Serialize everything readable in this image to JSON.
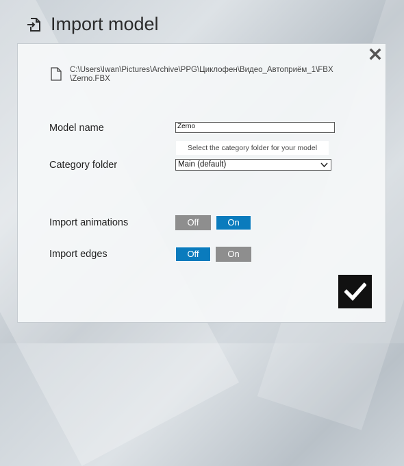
{
  "header": {
    "title": "Import model",
    "icon": "import-file-icon"
  },
  "dialog": {
    "close_icon": "close-icon",
    "file_path": "C:\\Users\\Iwan\\Pictures\\Archive\\PPG\\Циклофен\\Видео_Автоприём_1\\FBX\\Zerno.FBX",
    "model_name": {
      "label": "Model name",
      "value": "Zerno"
    },
    "category_folder": {
      "label": "Category folder",
      "hint": "Select the category folder for your model",
      "selected": "Main (default)"
    },
    "import_animations": {
      "label": "Import animations",
      "off_label": "Off",
      "on_label": "On",
      "selected": "On"
    },
    "import_edges": {
      "label": "Import edges",
      "off_label": "Off",
      "on_label": "On",
      "selected": "Off"
    },
    "confirm_icon": "checkmark-icon"
  },
  "colors": {
    "accent": "#0a7bbd",
    "inactive": "#8e8e8e",
    "confirm_bg": "#111111"
  }
}
